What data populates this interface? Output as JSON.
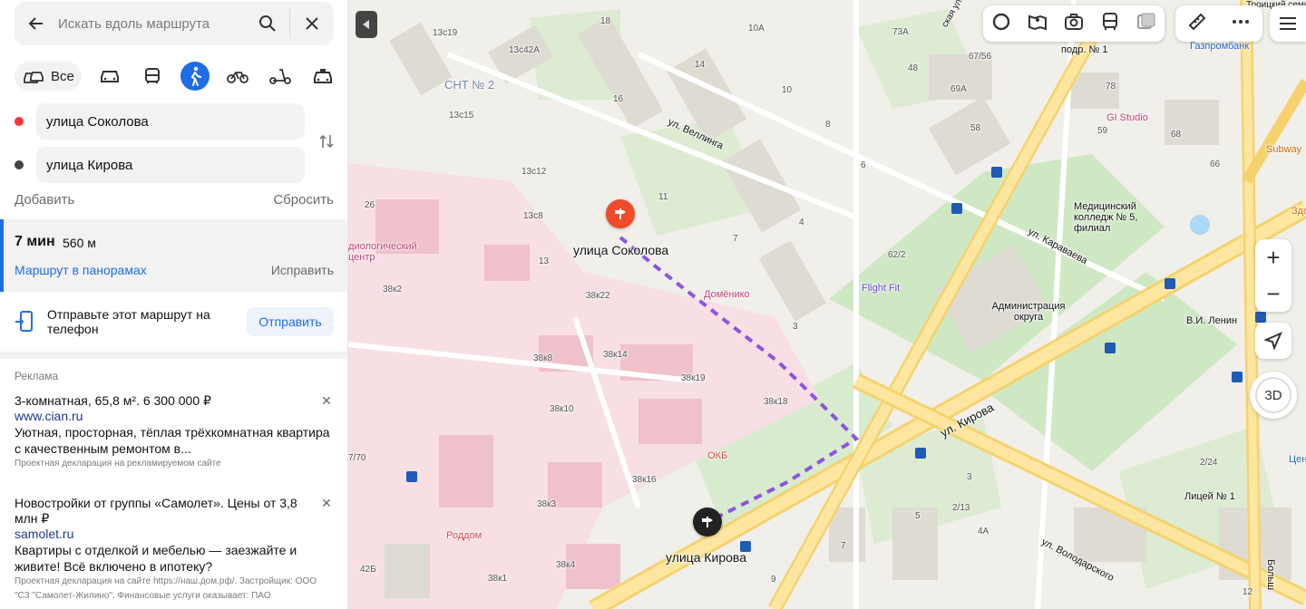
{
  "search": {
    "placeholder": "Искать вдоль маршрута",
    "icons": [
      "arrow-left-icon",
      "search-icon",
      "close-icon"
    ]
  },
  "modes": {
    "all_label": "Все",
    "active": "pedestrian",
    "items": [
      "car",
      "bus",
      "pedestrian",
      "bicycle",
      "scooter",
      "taxi"
    ]
  },
  "route_points": {
    "from": "улица Соколова",
    "to": "улица Кирова"
  },
  "route_actions": {
    "add": "Добавить",
    "reset": "Сбросить"
  },
  "route": {
    "time": "7 мин",
    "distance": "560 м",
    "panorama_link": "Маршрут в панорамах",
    "fix_link": "Исправить"
  },
  "send_to_phone": {
    "text": "Отправьте этот маршрут на телефон",
    "button": "Отправить"
  },
  "ads": {
    "heading": "Реклама",
    "items": [
      {
        "title": "3-комнатная, 65,8 м². 6 300 000 ₽",
        "url": "www.cian.ru",
        "desc": "Уютная, просторная, тёплая трёхкомнатная квартира с качественным ремонтом в...",
        "note": "Проектная декларация на рекламируемом сайте"
      },
      {
        "title": "Новостройки от группы «Самолет». Цены от 3,8 млн ₽",
        "url": "samolet.ru",
        "desc": "Квартиры с отделкой и мебелью — заезжайте и живите! Всё включено в ипотеку?",
        "note": "Проектная декларация на сайте https://наш.дом.рф/. Застройщик: ООО \"СЗ \"Самолет-Жилино\". Финансовые услуги оказывает: ПАО"
      }
    ]
  },
  "map": {
    "start_label": "улица Соколова",
    "end_label": "улица Кирова",
    "toolbar_icons": [
      "layers-icon",
      "panorama-icon",
      "camera-icon",
      "transit-icon",
      "overlay-icon"
    ],
    "ruler_icon": "ruler-icon",
    "more_icon": "more-icon",
    "zoom_in": "+",
    "zoom_out": "−",
    "three_d": "3D",
    "colors": {
      "route": "#8a55e0",
      "start_pin": "#f04b2a",
      "end_pin": "#222222",
      "accent": "#1f6de6"
    },
    "labels": [
      "СНТ № 2",
      "ул. Веллинга",
      "ул. Кирова",
      "ул. Караваева",
      "ул. Володарского",
      "Домёнико",
      "Flight Fit",
      "ОКБ",
      "Роддом",
      "Администрация округа",
      "Медицинский колледж № 5, филиал",
      "В.И. Ленин",
      "GI Studio",
      "Subway",
      "Газпромбанк",
      "Лицей № 1",
      "Центральный",
      "Здоровье",
      "подр. № 1",
      "диологический центр",
      "13с19",
      "13с42А",
      "13с15",
      "13с12",
      "13с8",
      "13",
      "38к22",
      "38к2",
      "38к8",
      "38к14",
      "38к19",
      "38к18",
      "38к10",
      "38к16",
      "38к3",
      "38к4",
      "38к1",
      "18",
      "16",
      "14",
      "10А",
      "10",
      "8",
      "6",
      "4",
      "11",
      "7",
      "3",
      "73А",
      "48",
      "69А",
      "58",
      "67/56",
      "78",
      "59",
      "68",
      "66",
      "62/2",
      "26",
      "7/70",
      "42Б",
      "5",
      "2/13",
      "4А",
      "3",
      "7",
      "9",
      "2/24",
      "12",
      "Больш",
      "Троицкий семинар",
      "ская ул."
    ]
  }
}
